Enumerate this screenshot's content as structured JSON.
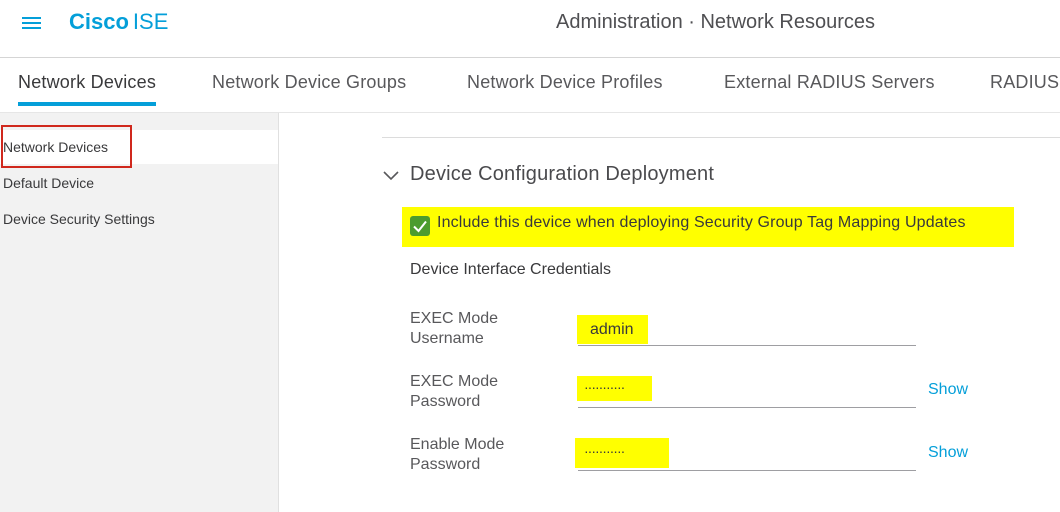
{
  "header": {
    "brand_bold": "Cisco",
    "brand_light": "ISE",
    "title": "Administration · Network Resources",
    "menu_icon": "hamburger-menu-icon"
  },
  "tabs": [
    {
      "label": "Network Devices",
      "active": true
    },
    {
      "label": "Network Device Groups",
      "active": false
    },
    {
      "label": "Network Device Profiles",
      "active": false
    },
    {
      "label": "External RADIUS Servers",
      "active": false
    },
    {
      "label": "RADIUS",
      "active": false
    }
  ],
  "sidebar": {
    "items": [
      {
        "label": "Network Devices",
        "active": true
      },
      {
        "label": "Default Device",
        "active": false
      },
      {
        "label": "Device Security Settings",
        "active": false
      }
    ]
  },
  "section": {
    "title": "Device Configuration Deployment",
    "expanded_icon": "chevron-down-icon",
    "checkbox_label": "Include this device when deploying Security Group Tag Mapping Updates",
    "checkbox_checked": true,
    "credentials_title": "Device Interface Credentials",
    "fields": [
      {
        "label_line1": "EXEC Mode",
        "label_line2": "Username",
        "value": "admin",
        "show": ""
      },
      {
        "label_line1": "EXEC Mode",
        "label_line2": "Password",
        "value": "···········",
        "show": "Show"
      },
      {
        "label_line1": "Enable Mode",
        "label_line2": "Password",
        "value": "···········",
        "show": "Show"
      }
    ]
  },
  "colors": {
    "accent": "#049fd9",
    "highlight": "#ffff00",
    "checkbox": "#4c9c2e",
    "annotation_border": "#d0281d"
  }
}
